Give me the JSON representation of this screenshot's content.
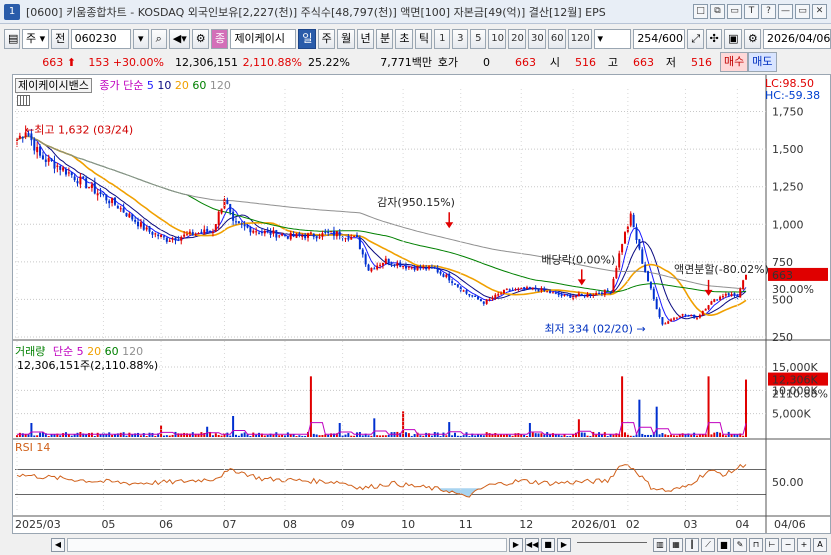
{
  "window": {
    "title": "[0600] 키움종합차트 - KOSDAQ 외국인보유[2,227(천)] 주식수[48,797(천)] 액면[100] 자본금[49(억)] 결산[12월] EPS",
    "icon_label": "1",
    "buttons": [
      "□",
      "⧉",
      "▭",
      "T",
      "?",
      "—",
      "▭",
      "✕"
    ]
  },
  "toolbar": {
    "market": "주",
    "prev_label": "전",
    "code": "060230",
    "type_badge": "종",
    "stock_name": "제이케이시",
    "period_active": "일",
    "periods": [
      "주",
      "월",
      "년",
      "분",
      "초",
      "틱"
    ],
    "intervals": [
      "1",
      "3",
      "5",
      "10",
      "20",
      "30",
      "60",
      "120"
    ],
    "count_value": "254",
    "count_total": "/600",
    "date": "2026/04/06"
  },
  "quote": {
    "price": "663",
    "change": "153",
    "change_pct": "+30.00%",
    "volume": "12,306,151",
    "volume_ratio": "2,110.88%",
    "turnover": "25.22%",
    "trade_value": "7,771백만",
    "bid_label": "호가",
    "bid_value": "0",
    "ask_value": "663",
    "open_label": "시",
    "open_value": "516",
    "high_label": "고",
    "high_value": "663",
    "low_label": "저",
    "low_value": "516",
    "buy_label": "매수",
    "sell_label": "매도"
  },
  "price_panel": {
    "name": "제이케이시밴스",
    "ma_title": "종가 단순",
    "ma_periods": [
      "5",
      "10",
      "20",
      "60",
      "120"
    ],
    "ma_colors": [
      "#1a1aff",
      "#0a0a80",
      "#f0a000",
      "#008000",
      "#909090"
    ],
    "lc_label": "LC:98.50",
    "hc_label": "HC:-59.38",
    "axis_ticks": [
      "1,750",
      "1,500",
      "1,250",
      "1,000",
      "750",
      "500",
      "250"
    ],
    "price_tag": "663",
    "pct_tag": "30.00%",
    "high_note": "최고 1,632 (03/24)",
    "low_note": "최저 334 (02/20)",
    "events": [
      {
        "label": "감자(950.15%)"
      },
      {
        "label": "배당락(0.00%)"
      },
      {
        "label": "액면분할(-80.02%)"
      }
    ]
  },
  "volume_panel": {
    "name": "거래량",
    "ma_title": "단순",
    "ma_periods": [
      "5",
      "20",
      "60",
      "120"
    ],
    "ma_colors": [
      "#c000c0",
      "#f0a000",
      "#008000",
      "#909090"
    ],
    "summary": "12,306,151주(2,110.88%)",
    "axis_ticks": [
      "15,000K",
      "10,000K",
      "5,000K"
    ],
    "vol_tag": "12,306K",
    "ratio_tag": "2110.88%"
  },
  "rsi_panel": {
    "name": "RSI 14",
    "axis_tick": "50.00"
  },
  "xaxis": {
    "labels": [
      "2025/03",
      "05",
      "06",
      "07",
      "08",
      "09",
      "10",
      "11",
      "12",
      "2026/01",
      "02",
      "03",
      "04"
    ],
    "end_label": "04/06"
  },
  "colors": {
    "up": "#e00000",
    "down": "#0030d0",
    "rsi": "#d0601a",
    "rsi_fill": "#a8d4f0"
  },
  "chart_data": {
    "type": "candlestick",
    "price_series_anchors": [
      [
        0,
        1560
      ],
      [
        3,
        1632
      ],
      [
        8,
        1450
      ],
      [
        15,
        1380
      ],
      [
        25,
        1250
      ],
      [
        35,
        1120
      ],
      [
        45,
        960
      ],
      [
        52,
        900
      ],
      [
        60,
        930
      ],
      [
        68,
        960
      ],
      [
        72,
        1180
      ],
      [
        75,
        1000
      ],
      [
        85,
        950
      ],
      [
        95,
        920
      ],
      [
        105,
        930
      ],
      [
        112,
        940
      ],
      [
        118,
        900
      ],
      [
        122,
        700
      ],
      [
        128,
        760
      ],
      [
        135,
        720
      ],
      [
        145,
        700
      ],
      [
        150,
        640
      ],
      [
        156,
        540
      ],
      [
        162,
        480
      ],
      [
        170,
        560
      ],
      [
        180,
        570
      ],
      [
        190,
        520
      ],
      [
        198,
        530
      ],
      [
        206,
        560
      ],
      [
        210,
        880
      ],
      [
        213,
        1050
      ],
      [
        217,
        750
      ],
      [
        221,
        500
      ],
      [
        224,
        334
      ],
      [
        230,
        400
      ],
      [
        236,
        380
      ],
      [
        240,
        470
      ],
      [
        246,
        540
      ],
      [
        250,
        520
      ],
      [
        253,
        663
      ]
    ],
    "ma_periods": [
      5,
      10,
      20,
      60,
      120
    ],
    "volume_spikes": [
      [
        5,
        3000
      ],
      [
        50,
        2500
      ],
      [
        66,
        2200
      ],
      [
        75,
        4500
      ],
      [
        102,
        13000
      ],
      [
        112,
        3000
      ],
      [
        124,
        4000
      ],
      [
        134,
        5500
      ],
      [
        150,
        3200
      ],
      [
        178,
        3000
      ],
      [
        195,
        3800
      ],
      [
        210,
        13000
      ],
      [
        216,
        8000
      ],
      [
        222,
        6500
      ],
      [
        240,
        13000
      ],
      [
        253,
        12306
      ]
    ],
    "rsi_anchors": [
      [
        0,
        62
      ],
      [
        10,
        58
      ],
      [
        25,
        52
      ],
      [
        40,
        48
      ],
      [
        55,
        50
      ],
      [
        68,
        55
      ],
      [
        75,
        70
      ],
      [
        85,
        55
      ],
      [
        100,
        52
      ],
      [
        112,
        50
      ],
      [
        120,
        40
      ],
      [
        130,
        48
      ],
      [
        140,
        42
      ],
      [
        150,
        36
      ],
      [
        155,
        26
      ],
      [
        158,
        30
      ],
      [
        163,
        44
      ],
      [
        175,
        52
      ],
      [
        185,
        48
      ],
      [
        195,
        50
      ],
      [
        205,
        52
      ],
      [
        210,
        80
      ],
      [
        214,
        72
      ],
      [
        220,
        42
      ],
      [
        226,
        35
      ],
      [
        232,
        42
      ],
      [
        240,
        68
      ],
      [
        246,
        62
      ],
      [
        253,
        80
      ]
    ],
    "ylim": [
      250,
      1900
    ],
    "volume_ylim": [
      0,
      18000
    ],
    "rsi_ylim": [
      0,
      100
    ]
  }
}
